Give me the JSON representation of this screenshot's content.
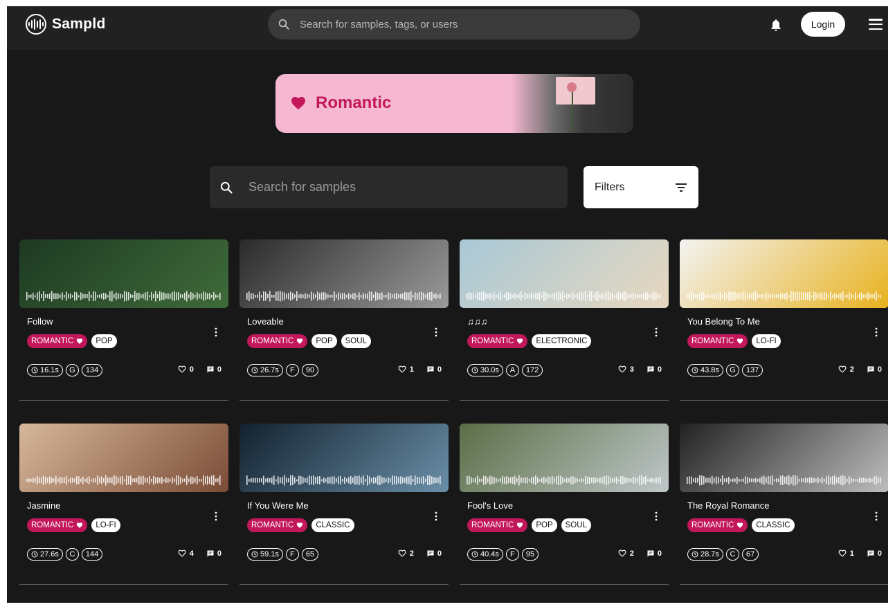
{
  "app": {
    "name": "Sampld",
    "search_placeholder": "Search for samples, tags, or users",
    "login_label": "Login"
  },
  "banner": {
    "title": "Romantic"
  },
  "samples_search": {
    "placeholder": "Search for samples",
    "filters_label": "Filters"
  },
  "colors": {
    "background": "#181818",
    "topbar": "#212121",
    "accent": "#c2185b",
    "banner_pink": "#f5b8d0"
  },
  "cards": [
    {
      "title": "Follow",
      "tags": [
        "ROMANTIC",
        "POP"
      ],
      "duration": "16.1s",
      "key": "G",
      "bpm": "134",
      "likes": "0",
      "comments": "0",
      "thumb_colors": [
        "#1e3a22",
        "#3f6b3a"
      ]
    },
    {
      "title": "Loveable",
      "tags": [
        "ROMANTIC",
        "POP",
        "SOUL"
      ],
      "duration": "26.7s",
      "key": "F",
      "bpm": "90",
      "likes": "1",
      "comments": "0",
      "thumb_colors": [
        "#2b2b2b",
        "#9a9a9a"
      ]
    },
    {
      "title": "♫♫♫",
      "tags": [
        "ROMANTIC",
        "ELECTRONIC"
      ],
      "duration": "30.0s",
      "key": "A",
      "bpm": "172",
      "likes": "3",
      "comments": "0",
      "thumb_colors": [
        "#a8c8d6",
        "#e8d8c0"
      ]
    },
    {
      "title": "You Belong To Me",
      "tags": [
        "ROMANTIC",
        "LO-FI"
      ],
      "duration": "43.8s",
      "key": "G",
      "bpm": "137",
      "likes": "2",
      "comments": "0",
      "thumb_colors": [
        "#f2f2f2",
        "#e8b21f"
      ]
    },
    {
      "title": "Jasmine",
      "tags": [
        "ROMANTIC",
        "LO-FI"
      ],
      "duration": "27.6s",
      "key": "C",
      "bpm": "144",
      "likes": "4",
      "comments": "0",
      "thumb_colors": [
        "#d7b79a",
        "#7a4c36"
      ]
    },
    {
      "title": "If You Were Me",
      "tags": [
        "ROMANTIC",
        "CLASSIC"
      ],
      "duration": "59.1s",
      "key": "F",
      "bpm": "65",
      "likes": "2",
      "comments": "0",
      "thumb_colors": [
        "#12212e",
        "#6a8fa8"
      ]
    },
    {
      "title": "Fool's Love",
      "tags": [
        "ROMANTIC",
        "POP",
        "SOUL"
      ],
      "duration": "40.4s",
      "key": "F",
      "bpm": "95",
      "likes": "2",
      "comments": "0",
      "thumb_colors": [
        "#5a6e46",
        "#bfc7c9"
      ]
    },
    {
      "title": "The Royal Romance",
      "tags": [
        "ROMANTIC",
        "CLASSIC"
      ],
      "duration": "28.7s",
      "key": "C",
      "bpm": "67",
      "likes": "1",
      "comments": "0",
      "thumb_colors": [
        "#222222",
        "#bdbdbd"
      ]
    }
  ]
}
